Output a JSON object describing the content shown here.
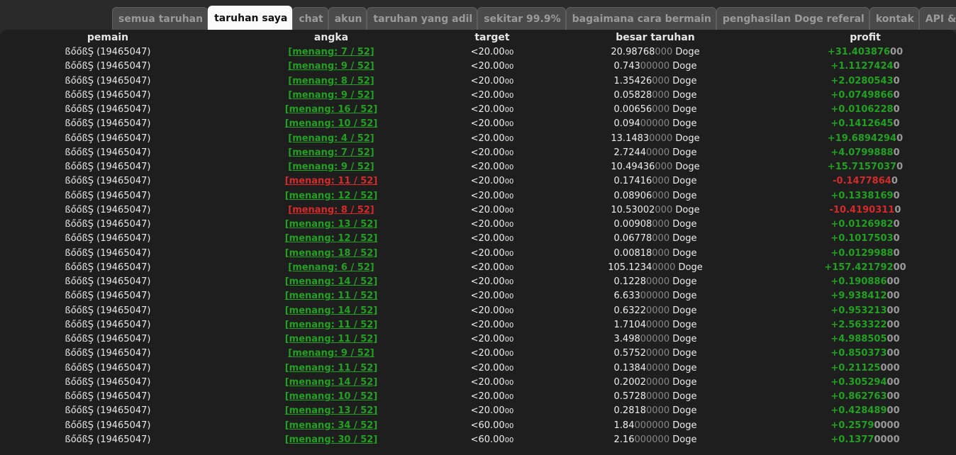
{
  "tabs": [
    {
      "label": "semua taruhan",
      "active": false
    },
    {
      "label": "taruhan saya",
      "active": true
    },
    {
      "label": "chat",
      "active": false
    },
    {
      "label": "akun",
      "active": false
    },
    {
      "label": "taruhan yang adil",
      "active": false
    },
    {
      "label": "sekitar 99.9%",
      "active": false
    },
    {
      "label": "bagaimana cara bermain",
      "active": false
    },
    {
      "label": "penghasilan Doge referal",
      "active": false
    },
    {
      "label": "kontak",
      "active": false
    },
    {
      "label": "API & bots",
      "active": false
    }
  ],
  "table": {
    "headers": {
      "player": "pemain",
      "angka": "angka",
      "target": "target",
      "bet": "besar taruhan",
      "profit": "profit"
    },
    "currency": "Doge",
    "rows": [
      {
        "player": "ßőőßŞ (19465047)",
        "result": "[menang: 7 / 52]",
        "win": true,
        "target_main": "<20.00",
        "target_dec": "00",
        "bet_main": "20.98768",
        "bet_pad": "000",
        "profit_main": "+31.403876",
        "profit_pad": "00",
        "profit_positive": true
      },
      {
        "player": "ßőőßŞ (19465047)",
        "result": "[menang: 9 / 52]",
        "win": true,
        "target_main": "<20.00",
        "target_dec": "00",
        "bet_main": "0.743",
        "bet_pad": "00000",
        "profit_main": "+1.1127424",
        "profit_pad": "0",
        "profit_positive": true
      },
      {
        "player": "ßőőßŞ (19465047)",
        "result": "[menang: 8 / 52]",
        "win": true,
        "target_main": "<20.00",
        "target_dec": "00",
        "bet_main": "1.35426",
        "bet_pad": "000",
        "profit_main": "+2.0280543",
        "profit_pad": "0",
        "profit_positive": true
      },
      {
        "player": "ßőőßŞ (19465047)",
        "result": "[menang: 9 / 52]",
        "win": true,
        "target_main": "<20.00",
        "target_dec": "00",
        "bet_main": "0.05828",
        "bet_pad": "000",
        "profit_main": "+0.0749866",
        "profit_pad": "0",
        "profit_positive": true
      },
      {
        "player": "ßőőßŞ (19465047)",
        "result": "[menang: 16 / 52]",
        "win": true,
        "target_main": "<20.00",
        "target_dec": "00",
        "bet_main": "0.00656",
        "bet_pad": "000",
        "profit_main": "+0.0106228",
        "profit_pad": "0",
        "profit_positive": true
      },
      {
        "player": "ßőőßŞ (19465047)",
        "result": "[menang: 10 / 52]",
        "win": true,
        "target_main": "<20.00",
        "target_dec": "00",
        "bet_main": "0.094",
        "bet_pad": "00000",
        "profit_main": "+0.1412645",
        "profit_pad": "0",
        "profit_positive": true
      },
      {
        "player": "ßőőßŞ (19465047)",
        "result": "[menang: 4 / 52]",
        "win": true,
        "target_main": "<20.00",
        "target_dec": "00",
        "bet_main": "13.1483",
        "bet_pad": "0000",
        "profit_main": "+19.6894294",
        "profit_pad": "0",
        "profit_positive": true
      },
      {
        "player": "ßőőßŞ (19465047)",
        "result": "[menang: 7 / 52]",
        "win": true,
        "target_main": "<20.00",
        "target_dec": "00",
        "bet_main": "2.7244",
        "bet_pad": "0000",
        "profit_main": "+4.0799888",
        "profit_pad": "0",
        "profit_positive": true
      },
      {
        "player": "ßőőßŞ (19465047)",
        "result": "[menang: 9 / 52]",
        "win": true,
        "target_main": "<20.00",
        "target_dec": "00",
        "bet_main": "10.49436",
        "bet_pad": "000",
        "profit_main": "+15.7157037",
        "profit_pad": "0",
        "profit_positive": true
      },
      {
        "player": "ßőőßŞ (19465047)",
        "result": "[menang: 11 / 52]",
        "win": false,
        "target_main": "<20.00",
        "target_dec": "00",
        "bet_main": "0.17416",
        "bet_pad": "000",
        "profit_main": "-0.1477864",
        "profit_pad": "0",
        "profit_positive": false
      },
      {
        "player": "ßőőßŞ (19465047)",
        "result": "[menang: 12 / 52]",
        "win": true,
        "target_main": "<20.00",
        "target_dec": "00",
        "bet_main": "0.08906",
        "bet_pad": "000",
        "profit_main": "+0.1338169",
        "profit_pad": "0",
        "profit_positive": true
      },
      {
        "player": "ßőőßŞ (19465047)",
        "result": "[menang: 8 / 52]",
        "win": false,
        "target_main": "<20.00",
        "target_dec": "00",
        "bet_main": "10.53002",
        "bet_pad": "000",
        "profit_main": "-10.4190311",
        "profit_pad": "0",
        "profit_positive": false
      },
      {
        "player": "ßőőßŞ (19465047)",
        "result": "[menang: 13 / 52]",
        "win": true,
        "target_main": "<20.00",
        "target_dec": "00",
        "bet_main": "0.00908",
        "bet_pad": "000",
        "profit_main": "+0.0126982",
        "profit_pad": "0",
        "profit_positive": true
      },
      {
        "player": "ßőőßŞ (19465047)",
        "result": "[menang: 12 / 52]",
        "win": true,
        "target_main": "<20.00",
        "target_dec": "00",
        "bet_main": "0.06778",
        "bet_pad": "000",
        "profit_main": "+0.1017503",
        "profit_pad": "0",
        "profit_positive": true
      },
      {
        "player": "ßőőßŞ (19465047)",
        "result": "[menang: 18 / 52]",
        "win": true,
        "target_main": "<20.00",
        "target_dec": "00",
        "bet_main": "0.00818",
        "bet_pad": "000",
        "profit_main": "+0.0129988",
        "profit_pad": "0",
        "profit_positive": true
      },
      {
        "player": "ßőőßŞ (19465047)",
        "result": "[menang: 6 / 52]",
        "win": true,
        "target_main": "<20.00",
        "target_dec": "00",
        "bet_main": "105.1234",
        "bet_pad": "0000",
        "profit_main": "+157.421792",
        "profit_pad": "00",
        "profit_positive": true
      },
      {
        "player": "ßőőßŞ (19465047)",
        "result": "[menang: 14 / 52]",
        "win": true,
        "target_main": "<20.00",
        "target_dec": "00",
        "bet_main": "0.1228",
        "bet_pad": "0000",
        "profit_main": "+0.190886",
        "profit_pad": "00",
        "profit_positive": true
      },
      {
        "player": "ßőőßŞ (19465047)",
        "result": "[menang: 11 / 52]",
        "win": true,
        "target_main": "<20.00",
        "target_dec": "00",
        "bet_main": "6.633",
        "bet_pad": "00000",
        "profit_main": "+9.938412",
        "profit_pad": "00",
        "profit_positive": true
      },
      {
        "player": "ßőőßŞ (19465047)",
        "result": "[menang: 14 / 52]",
        "win": true,
        "target_main": "<20.00",
        "target_dec": "00",
        "bet_main": "0.6322",
        "bet_pad": "0000",
        "profit_main": "+0.953213",
        "profit_pad": "00",
        "profit_positive": true
      },
      {
        "player": "ßőőßŞ (19465047)",
        "result": "[menang: 11 / 52]",
        "win": true,
        "target_main": "<20.00",
        "target_dec": "00",
        "bet_main": "1.7104",
        "bet_pad": "0000",
        "profit_main": "+2.563322",
        "profit_pad": "00",
        "profit_positive": true
      },
      {
        "player": "ßőőßŞ (19465047)",
        "result": "[menang: 11 / 52]",
        "win": true,
        "target_main": "<20.00",
        "target_dec": "00",
        "bet_main": "3.498",
        "bet_pad": "00000",
        "profit_main": "+4.988505",
        "profit_pad": "00",
        "profit_positive": true
      },
      {
        "player": "ßőőßŞ (19465047)",
        "result": "[menang: 9 / 52]",
        "win": true,
        "target_main": "<20.00",
        "target_dec": "00",
        "bet_main": "0.5752",
        "bet_pad": "0000",
        "profit_main": "+0.850373",
        "profit_pad": "00",
        "profit_positive": true
      },
      {
        "player": "ßőőßŞ (19465047)",
        "result": "[menang: 11 / 52]",
        "win": true,
        "target_main": "<20.00",
        "target_dec": "00",
        "bet_main": "0.1384",
        "bet_pad": "0000",
        "profit_main": "+0.21125",
        "profit_pad": "000",
        "profit_positive": true
      },
      {
        "player": "ßőőßŞ (19465047)",
        "result": "[menang: 14 / 52]",
        "win": true,
        "target_main": "<20.00",
        "target_dec": "00",
        "bet_main": "0.2002",
        "bet_pad": "0000",
        "profit_main": "+0.305294",
        "profit_pad": "00",
        "profit_positive": true
      },
      {
        "player": "ßőőßŞ (19465047)",
        "result": "[menang: 10 / 52]",
        "win": true,
        "target_main": "<20.00",
        "target_dec": "00",
        "bet_main": "0.5728",
        "bet_pad": "0000",
        "profit_main": "+0.862763",
        "profit_pad": "00",
        "profit_positive": true
      },
      {
        "player": "ßőőßŞ (19465047)",
        "result": "[menang: 13 / 52]",
        "win": true,
        "target_main": "<20.00",
        "target_dec": "00",
        "bet_main": "0.2818",
        "bet_pad": "0000",
        "profit_main": "+0.428489",
        "profit_pad": "00",
        "profit_positive": true
      },
      {
        "player": "ßőőßŞ (19465047)",
        "result": "[menang: 34 / 52]",
        "win": true,
        "target_main": "<60.00",
        "target_dec": "00",
        "bet_main": "1.84",
        "bet_pad": "000000",
        "profit_main": "+0.2579",
        "profit_pad": "0000",
        "profit_positive": true
      },
      {
        "player": "ßőőßŞ (19465047)",
        "result": "[menang: 30 / 52]",
        "win": true,
        "target_main": "<60.00",
        "target_dec": "00",
        "bet_main": "2.16",
        "bet_pad": "000000",
        "profit_main": "+0.1377",
        "profit_pad": "0000",
        "profit_positive": true
      }
    ]
  }
}
